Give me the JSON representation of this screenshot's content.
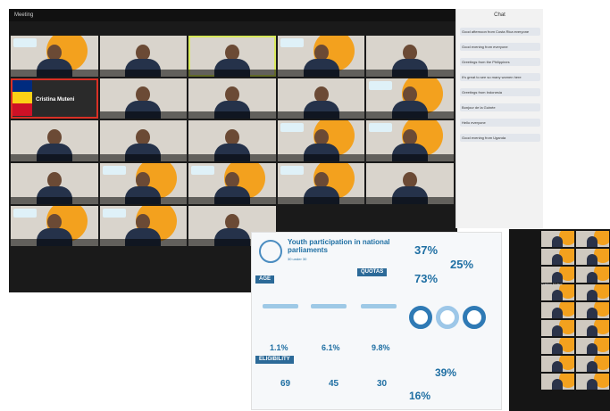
{
  "gallery": {
    "window_title": "Meeting",
    "tiles": [
      {
        "name": "",
        "orange": true
      },
      {
        "name": "",
        "orange": false
      },
      {
        "name": "",
        "orange": false,
        "selected": true
      },
      {
        "name": "",
        "orange": true
      },
      {
        "name": "",
        "orange": false
      },
      {
        "name": "Cristina Muteni",
        "flag": true
      },
      {
        "name": "",
        "orange": false
      },
      {
        "name": "",
        "orange": false
      },
      {
        "name": "",
        "orange": false
      },
      {
        "name": "",
        "orange": true
      },
      {
        "name": "",
        "orange": false
      },
      {
        "name": "",
        "orange": false
      },
      {
        "name": "",
        "orange": false
      },
      {
        "name": "",
        "orange": true
      },
      {
        "name": "",
        "orange": true
      },
      {
        "name": "",
        "orange": false
      },
      {
        "name": "",
        "orange": true
      },
      {
        "name": "",
        "orange": true
      },
      {
        "name": "",
        "orange": true
      },
      {
        "name": "",
        "orange": false
      },
      {
        "name": "",
        "orange": true
      },
      {
        "name": "",
        "orange": true
      },
      {
        "name": "",
        "orange": false
      }
    ]
  },
  "chat": {
    "title": "Chat",
    "messages": [
      {
        "from": "",
        "text": "Good afternoon from Costa Rica everyone"
      },
      {
        "from": "",
        "text": "Good evening from everyone"
      },
      {
        "from": "",
        "text": "Greetings from the Philippines"
      },
      {
        "from": "",
        "text": "It's great to see so many women here"
      },
      {
        "from": "",
        "text": "Greetings from Indonesia"
      },
      {
        "from": "",
        "text": "Bonjour de la Guinée"
      },
      {
        "from": "",
        "text": "Hello everyone"
      },
      {
        "from": "",
        "text": "Good evening from Uganda"
      }
    ]
  },
  "infographic": {
    "title": "Youth participation in national parliaments",
    "subtitle": "30 under 30",
    "sections": [
      "AGE",
      "QUOTAS",
      "ELIGIBILITY"
    ],
    "stats": {
      "s37": "37%",
      "s25": "25%",
      "s73": "73%",
      "s1_1": "1.1%",
      "s6_1": "6.1%",
      "s9_8": "9.8%",
      "s69": "69",
      "s45": "45",
      "s30": "30",
      "s39": "39%",
      "s16": "16%"
    }
  },
  "side": {
    "label": "Cristina Muteni"
  },
  "colors": {
    "ipu_orange": "#f3a11e",
    "ipu_blue": "#1f6fa3",
    "active_speaker": "#d7e85a"
  }
}
